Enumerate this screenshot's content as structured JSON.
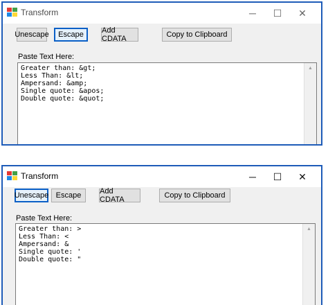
{
  "windows": [
    {
      "title": "Transform",
      "buttons": {
        "unescape": "Unescape",
        "escape": "Escape",
        "add_cdata": "Add CDATA",
        "copy": "Copy to Clipboard"
      },
      "paste_label": "Paste Text Here:",
      "lines": [
        "Greater than: &gt;",
        "Less Than: &lt;",
        "Ampersand: &amp;",
        "Single quote: &apos;",
        "Double quote: &quot;"
      ]
    },
    {
      "title": "Transform",
      "buttons": {
        "unescape": "Unescape",
        "escape": "Escape",
        "add_cdata": "Add CDATA",
        "copy": "Copy to Clipboard"
      },
      "paste_label": "Paste Text Here:",
      "lines": [
        "Greater than: >",
        "Less Than: <",
        "Ampersand: &",
        "Single quote: '",
        "Double quote: \""
      ]
    }
  ],
  "titlebar": {
    "minimize": "─",
    "maximize": "☐",
    "close": "✕"
  },
  "scroll": {
    "up": "▲"
  },
  "colors": {
    "window_border": "#1d5bb8",
    "focus_border": "#0a5fc6"
  }
}
